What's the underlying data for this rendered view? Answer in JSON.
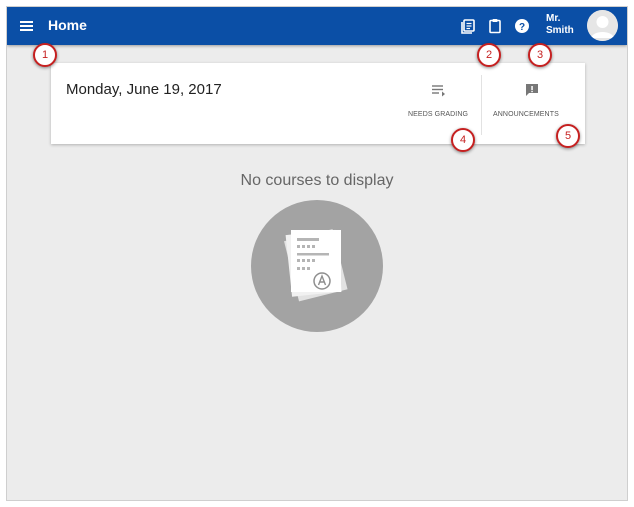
{
  "header": {
    "title": "Home",
    "user_line1": "Mr.",
    "user_line2": "Smith",
    "icons": [
      "menu-icon",
      "classes-icon",
      "clipboard-icon",
      "help-icon",
      "avatar"
    ],
    "bar_color": "#0b4fa6"
  },
  "card": {
    "date": "Monday, June 19, 2017",
    "needs_grading_label": "NEEDS GRADING",
    "announcements_label": "ANNOUNCEMENTS"
  },
  "main": {
    "empty_message": "No courses to display"
  },
  "callouts": [
    "1",
    "2",
    "3",
    "4",
    "5"
  ],
  "colors": {
    "background": "#ececec",
    "callout_border": "#c62020",
    "empty_circle": "#a3a3a3"
  }
}
